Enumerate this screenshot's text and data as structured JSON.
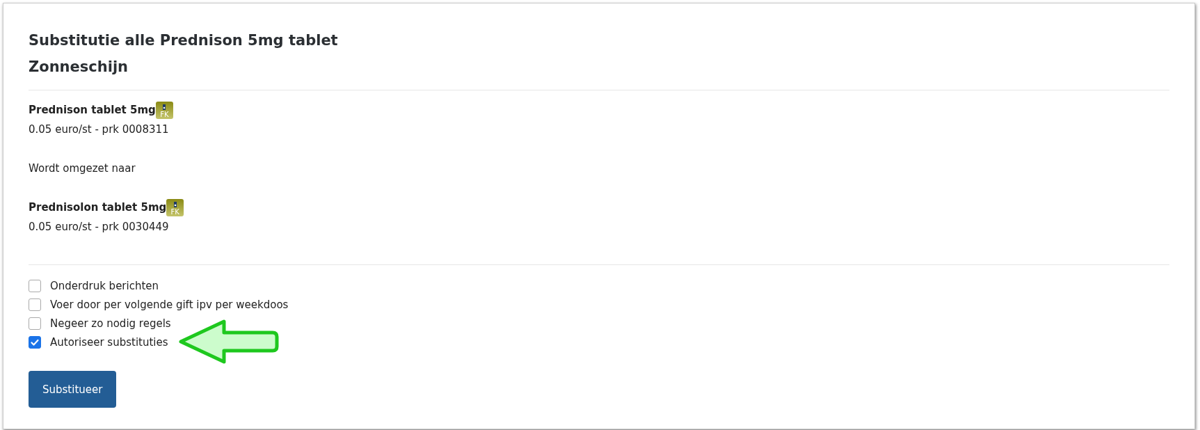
{
  "title_lines": [
    "Substitutie alle Prednison 5mg tablet",
    "Zonneschijn"
  ],
  "from_product": {
    "name": "Prednison tablet 5mg",
    "badge": "FK",
    "details": "0.05 euro/st - prk 0008311"
  },
  "conversion_text": "Wordt omgezet naar",
  "to_product": {
    "name": "Prednisolon tablet 5mg",
    "badge": "FK",
    "details": "0.05 euro/st - prk 0030449"
  },
  "options": [
    {
      "label": "Onderdruk berichten",
      "checked": false
    },
    {
      "label": "Voer door per volgende gift ipv per weekdoos",
      "checked": false
    },
    {
      "label": "Negeer zo nodig regels",
      "checked": false
    },
    {
      "label": "Autoriseer substituties",
      "checked": true,
      "arrow_annotation": true
    }
  ],
  "submit_button": "Substitueer"
}
